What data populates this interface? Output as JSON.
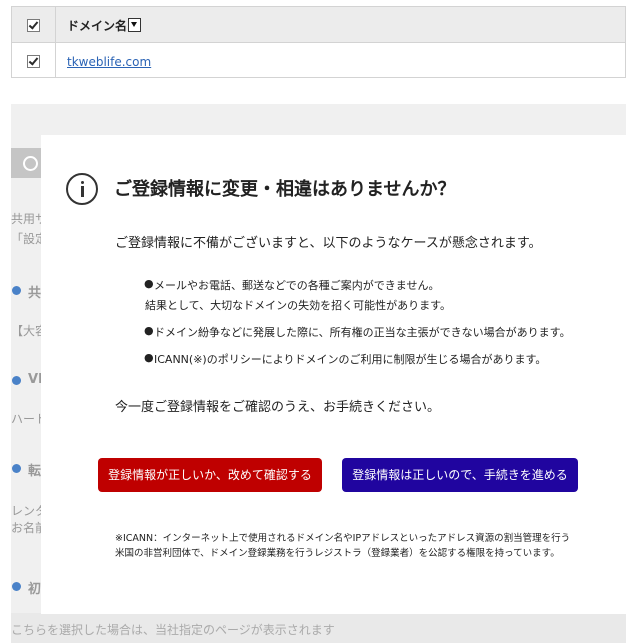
{
  "domain_table": {
    "header_label": "ドメイン名",
    "rows": [
      {
        "domain": "tkweblife.com",
        "checked": true
      }
    ]
  },
  "background": {
    "partial_texts": [
      "共用サ",
      "「設定",
      "共",
      "【大容",
      "VP",
      "ハート",
      "転",
      "レンタ",
      "お名前",
      "初"
    ],
    "bottom_text": "こちらを選択した場合は、当社指定のページが表示されます"
  },
  "modal": {
    "icon": "info-icon",
    "title": "ご登録情報に変更・相違はありませんか？",
    "lead": "ご登録情報に不備がございますと、以下のようなケースが懸念されます。",
    "bullets": [
      "メールやお電話、郵送などでの各種ご案内ができません。",
      "結果として、大切なドメインの失効を招く可能性があります。",
      "ドメイン紛争などに発展した際に、所有権の正当な主張ができない場合があります。",
      "ICANN(※)のポリシーによりドメインのご利用に制限が生じる場合があります。"
    ],
    "closing": "今一度ご登録情報をご確認のうえ、お手続きください。",
    "buttons": {
      "recheck_label": "登録情報が正しいか、改めて確認する",
      "proceed_label": "登録情報は正しいので、手続きを進める"
    },
    "footnote": "※ICANN：インターネット上で使用されるドメイン名やIPアドレスといったアドレス資源の割当管理を行う米国の非営利団体で、ドメイン登録業務を行うレジストラ（登録業者）を公認する権限を持っています。"
  },
  "colors": {
    "recheck_button": "#bf0000",
    "proceed_button": "#20059f",
    "link": "#2a63b5",
    "bullet_dot": "#4a82c8"
  }
}
